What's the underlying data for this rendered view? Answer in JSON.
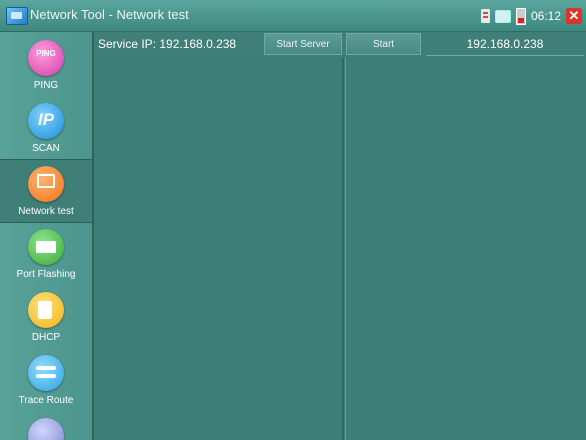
{
  "window": {
    "title": "Network Tool - Network test"
  },
  "status": {
    "time": "06:12"
  },
  "sidebar": {
    "items": [
      {
        "label": "PING",
        "icon": "ping-icon",
        "icon_text": "PING"
      },
      {
        "label": "SCAN",
        "icon": "ip-scan-icon",
        "icon_text": "IP"
      },
      {
        "label": "Network test",
        "icon": "network-test-icon",
        "active": true
      },
      {
        "label": "Port Flashing",
        "icon": "port-flashing-icon"
      },
      {
        "label": "DHCP",
        "icon": "dhcp-icon"
      },
      {
        "label": "Trace Route",
        "icon": "trace-route-icon"
      }
    ]
  },
  "toolbar": {
    "service_ip_label": "Service IP: 192.168.0.238",
    "start_server_label": "Start Server",
    "start_label": "Start",
    "target_ip": "192.168.0.238"
  },
  "colors": {
    "background": "#3f7f78",
    "sidebar": "#4d958c",
    "titlebar": "#5aa59d",
    "close": "#d9352a"
  }
}
